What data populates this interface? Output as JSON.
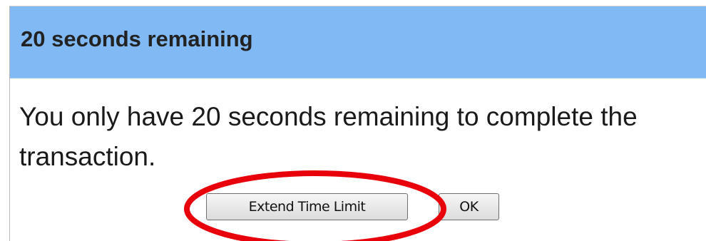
{
  "dialog": {
    "title": "20 seconds remaining",
    "message": "You only have 20 seconds remaining to complete the transaction.",
    "buttons": {
      "extend_label": "Extend Time Limit",
      "ok_label": "OK"
    }
  },
  "colors": {
    "title_bar": "#80b9f3",
    "highlight_ring": "#e8000b"
  }
}
